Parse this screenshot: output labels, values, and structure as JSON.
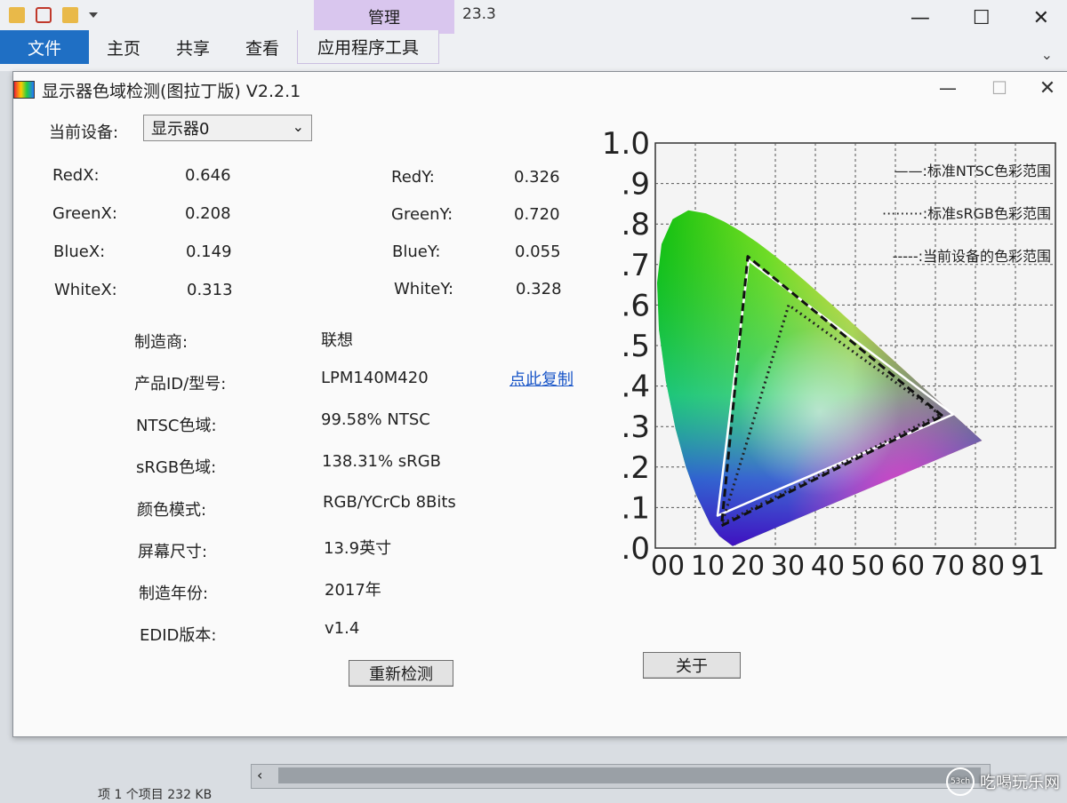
{
  "explorer": {
    "manage_tab": "管理",
    "path_text": "23.3",
    "tabs": [
      "文件",
      "主页",
      "共享",
      "查看",
      "应用程序工具"
    ],
    "win_min": "—",
    "win_max": "☐",
    "win_close": "✕",
    "expand": "⌄",
    "status": "项 1 个项目 232 KB"
  },
  "app": {
    "title": "显示器色域检测(图拉丁版) V2.2.1",
    "min": "—",
    "max": "☐",
    "close": "✕",
    "device_label": "当前设备:",
    "device_value": "显示器0",
    "coords": [
      {
        "label": "RedX:",
        "value": "0.646"
      },
      {
        "label": "RedY:",
        "value": "0.326"
      },
      {
        "label": "GreenX:",
        "value": "0.208"
      },
      {
        "label": "GreenY:",
        "value": "0.720"
      },
      {
        "label": "BlueX:",
        "value": "0.149"
      },
      {
        "label": "BlueY:",
        "value": "0.055"
      },
      {
        "label": "WhiteX:",
        "value": "0.313"
      },
      {
        "label": "WhiteY:",
        "value": "0.328"
      }
    ],
    "info": [
      {
        "label": "制造商:",
        "value": "联想"
      },
      {
        "label": "产品ID/型号:",
        "value": "LPM140M420"
      },
      {
        "label": "NTSC色域:",
        "value": "99.58% NTSC"
      },
      {
        "label": "sRGB色域:",
        "value": "138.31% sRGB"
      },
      {
        "label": "颜色模式:",
        "value": "RGB/YCrCb 8Bits"
      },
      {
        "label": "屏幕尺寸:",
        "value": "13.9英寸"
      },
      {
        "label": "制造年份:",
        "value": "2017年"
      },
      {
        "label": "EDID版本:",
        "value": "v1.4"
      }
    ],
    "copy_link": "点此复制",
    "redetect_button": "重新检测",
    "about_button": "关于"
  },
  "chart_data": {
    "type": "scatter",
    "y_tick_labels": [
      ".0",
      ".1",
      ".2",
      ".3",
      ".4",
      ".5",
      ".6",
      ".7",
      ".8",
      ".9",
      "1.0"
    ],
    "x_tick_labels": [
      "00",
      "10",
      "20",
      "30",
      "40",
      "50",
      "60",
      "70",
      "80",
      "91"
    ],
    "xlim": [
      0,
      0.9
    ],
    "ylim": [
      0,
      1.0
    ],
    "grid": true,
    "legend_position": "top-right",
    "legend": [
      "——:标准NTSC色彩范围",
      "·········:标准sRGB色彩范围",
      "-----:当前设备的色彩范围"
    ],
    "series": [
      {
        "name": "标准NTSC色彩范围",
        "style": "solid",
        "color": "#ffffff",
        "points": [
          [
            0.67,
            0.33
          ],
          [
            0.21,
            0.71
          ],
          [
            0.14,
            0.08
          ]
        ]
      },
      {
        "name": "标准sRGB色彩范围",
        "style": "dotted",
        "color": "#222222",
        "points": [
          [
            0.64,
            0.33
          ],
          [
            0.3,
            0.6
          ],
          [
            0.15,
            0.06
          ]
        ]
      },
      {
        "name": "当前设备的色彩范围",
        "style": "dashed",
        "color": "#111111",
        "points": [
          [
            0.646,
            0.326
          ],
          [
            0.208,
            0.72
          ],
          [
            0.149,
            0.055
          ]
        ]
      }
    ]
  }
}
